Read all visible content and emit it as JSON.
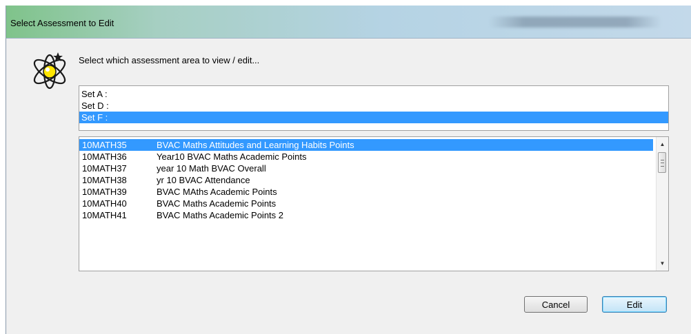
{
  "window": {
    "title": "Select Assessment to Edit",
    "blurred_title": "BVAC Maths Academic Points"
  },
  "prompt": "Select which assessment area to view / edit...",
  "sets": [
    {
      "label": "Set A :",
      "selected": false
    },
    {
      "label": "Set D :",
      "selected": false
    },
    {
      "label": "Set F :",
      "selected": true
    }
  ],
  "assessments": [
    {
      "code": "10MATH35",
      "name": "BVAC Maths Attitudes and Learning Habits Points",
      "selected": true
    },
    {
      "code": "10MATH36",
      "name": "Year10 BVAC Maths Academic Points",
      "selected": false
    },
    {
      "code": "10MATH37",
      "name": "year 10 Math BVAC Overall",
      "selected": false
    },
    {
      "code": "10MATH38",
      "name": "yr 10 BVAC Attendance",
      "selected": false
    },
    {
      "code": "10MATH39",
      "name": "BVAC MAths Academic Points",
      "selected": false
    },
    {
      "code": "10MATH40",
      "name": "BVAC Maths Academic Points",
      "selected": false
    },
    {
      "code": "10MATH41",
      "name": "BVAC Maths Academic Points 2",
      "selected": false
    }
  ],
  "buttons": {
    "cancel": "Cancel",
    "edit": "Edit"
  },
  "icons": {
    "app": "atom-star-icon",
    "scroll_up": "scroll-up-arrow-icon",
    "scroll_down": "scroll-down-arrow-icon"
  },
  "colors": {
    "selection": "#3399ff",
    "titlebar_start": "#7fc38a",
    "titlebar_end": "#c3d9ea"
  }
}
